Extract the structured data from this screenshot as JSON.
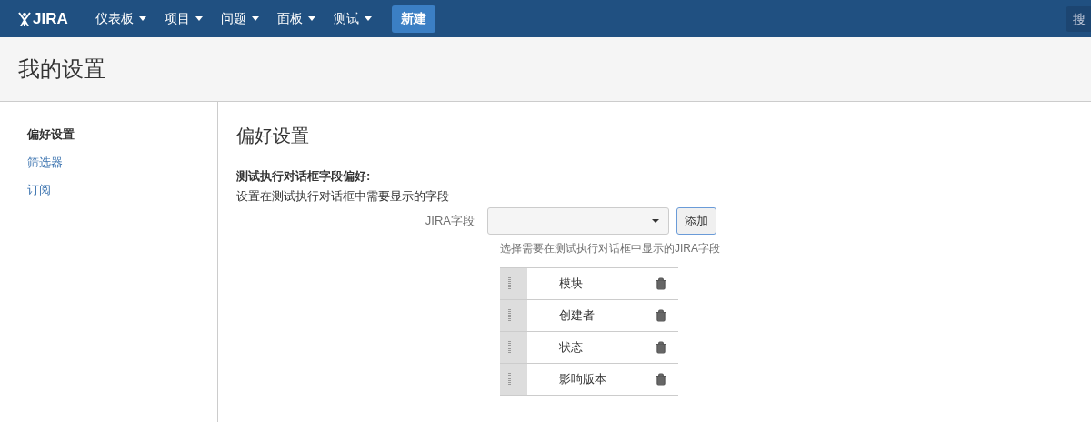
{
  "header": {
    "logo": "JIRA",
    "menus": [
      {
        "label": "仪表板"
      },
      {
        "label": "项目"
      },
      {
        "label": "问题"
      },
      {
        "label": "面板"
      },
      {
        "label": "测试"
      }
    ],
    "create_button": "新建",
    "search": {
      "placeholder": "搜"
    }
  },
  "page_title": "我的设置",
  "sidebar": {
    "items": [
      {
        "label": "偏好设置",
        "selected": true
      },
      {
        "label": "筛选器",
        "selected": false
      },
      {
        "label": "订阅",
        "selected": false
      }
    ]
  },
  "content": {
    "heading": "偏好设置",
    "section_title": "测试执行对话框字段偏好:",
    "section_description": "设置在测试执行对话框中需要显示的字段",
    "field_label": "JIRA字段",
    "add_button": "添加",
    "help_text": "选择需要在测试执行对话框中显示的JIRA字段",
    "fields": [
      {
        "name": "模块"
      },
      {
        "name": "创建者"
      },
      {
        "name": "状态"
      },
      {
        "name": "影响版本"
      }
    ]
  }
}
